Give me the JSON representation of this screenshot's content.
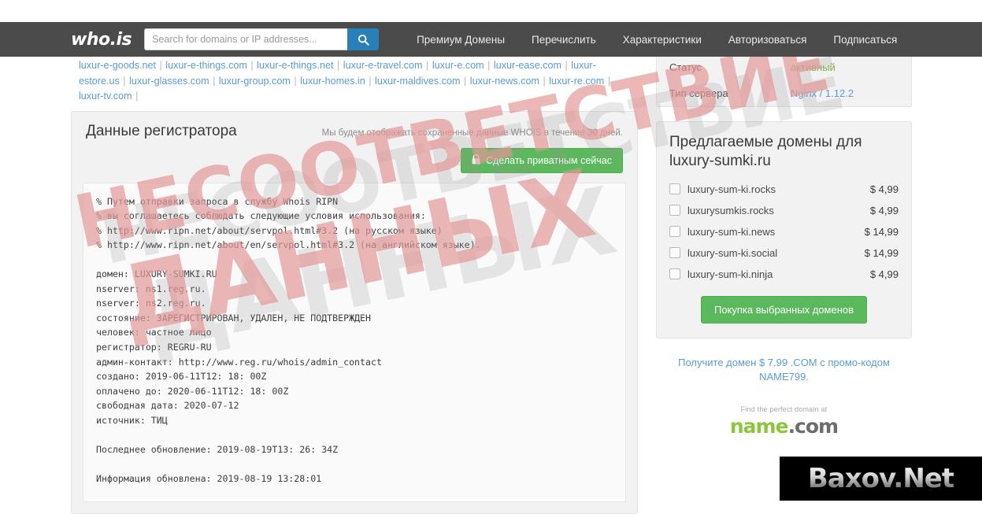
{
  "header": {
    "logo_text": "who.is",
    "search": {
      "placeholder": "Search for domains or IP addresses...",
      "value": "",
      "button_icon": "search-icon"
    },
    "nav": [
      {
        "label": "Премиум Домены"
      },
      {
        "label": "Перечислить"
      },
      {
        "label": "Характеристики"
      },
      {
        "label": "Авторизоваться"
      },
      {
        "label": "Подписаться"
      }
    ]
  },
  "related_domains": {
    "row1": [
      "luxur-e-goods.net",
      "luxur-e-things.com",
      "luxur-e-things.net",
      "luxur-e-travel.com",
      "luxur-e.com",
      "luxur-ease.com",
      "luxur-estore.us"
    ],
    "row2": [
      "luxur-glasses.com",
      "luxur-group.com",
      "luxur-homes.in",
      "luxur-maldives.com",
      "luxur-news.com",
      "luxur-re.com",
      "luxur-tv.com"
    ],
    "separator": "|"
  },
  "registrar_panel": {
    "title": "Данные регистратора",
    "note": "Мы будем отображать сохраненные данные WHOIS в течение 30 дней.",
    "private_button": {
      "label": "Сделать приватным сейчас",
      "icon": "lock-icon"
    },
    "whois_text": "% Путем отправки запроса в службу Whois RIPN\n% вы соглашаетесь соблюдать следующие условия использования:\n% http://www.ripn.net/about/servpol.html#3.2 (на русском языке)\n% http://www.ripn.net/about/en/servpol.html#3.2 (на английском языке).\n\nдомен: LUXURY-SUMKI.RU\nnserver: ns1.reg.ru.\nnserver: ns2.reg.ru.\nсостояние: ЗАРЕГИСТРИРОВАН, УДАЛЕН, НЕ ПОДТВЕРЖДЕН\nчеловек: частное лицо\nрегистратор: REGRU-RU\nадмин-контакт: http://www.reg.ru/whois/admin_contact\nсоздано: 2019-06-11T12: 18: 00Z\nоплачено до: 2020-06-11T12: 18: 00Z\nсвободная дата: 2020-07-12\nисточник: ТИЦ\n\nПоследнее обновление: 2019-08-19T13: 26: 34Z\n\nИнформация обновлена: 2019-08-19 13:28:01"
  },
  "sidebar": {
    "info_rows": [
      {
        "key": "Статус",
        "value": "активный",
        "value_style": "status"
      },
      {
        "key": "Тип сервера",
        "value": "Nginx / 1.12.2",
        "value_style": "server"
      }
    ],
    "suggestions": {
      "title": "Предлагаемые домены для luxury-sumki.ru",
      "items": [
        {
          "name": "luxury-sum-ki.rocks",
          "price": "$ 4,99",
          "checked": false
        },
        {
          "name": "luxurysumkis.rocks",
          "price": "$ 4,99",
          "checked": false
        },
        {
          "name": "luxury-sum-ki.news",
          "price": "$ 14,99",
          "checked": false
        },
        {
          "name": "luxury-sum-ki.social",
          "price": "$ 14,99",
          "checked": false
        },
        {
          "name": "luxury-sum-ki.ninja",
          "price": "$ 4,99",
          "checked": false
        }
      ],
      "buy_button_label": "Покупка выбранных доменов"
    },
    "promo_text": "Получите домен $ 7.99 .COM с промо-кодом NAME799.",
    "namecom": {
      "tagline": "Find the perfect domain at",
      "brand_green": "name",
      "brand_grey": ".com"
    }
  },
  "watermarks": {
    "stamp_line1": "НЕСООТВЕТСТВИЕ",
    "stamp_line2": "ДАННЫХ",
    "stamp_color": "#d66262",
    "site_watermark": "Baxov.Net"
  },
  "colors": {
    "header_bg": "#4b4b4b",
    "accent_blue": "#2980b9",
    "accent_green": "#5cb85c",
    "link_blue": "#5b9bd5",
    "status_green": "#7cb342",
    "panel_bg": "#f2f2f2"
  }
}
